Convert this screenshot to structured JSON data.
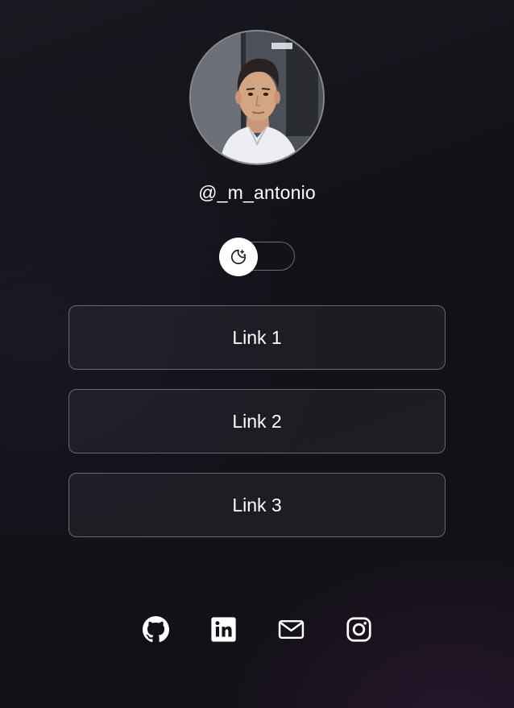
{
  "profile": {
    "username": "@_m_antonio",
    "avatar_alt": "profile photo"
  },
  "theme_toggle": {
    "mode": "dark",
    "icon": "moon-stars-icon"
  },
  "links": [
    {
      "label": "Link 1"
    },
    {
      "label": "Link 2"
    },
    {
      "label": "Link 3"
    }
  ],
  "socials": [
    {
      "name": "github",
      "icon": "github-icon"
    },
    {
      "name": "linkedin",
      "icon": "linkedin-icon"
    },
    {
      "name": "email",
      "icon": "mail-icon"
    },
    {
      "name": "instagram",
      "icon": "instagram-icon"
    }
  ],
  "colors": {
    "background": "#131218",
    "text": "#ffffff",
    "border": "#6b6970",
    "button_fill": "#2e2b34"
  }
}
